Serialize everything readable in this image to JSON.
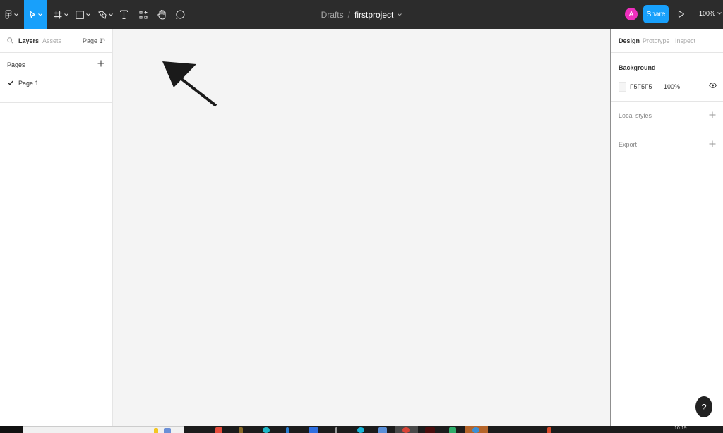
{
  "toolbar": {
    "tools": [
      {
        "name": "main-menu",
        "icon": "figma-logo-icon"
      },
      {
        "name": "move",
        "icon": "move-cursor-icon",
        "active": true
      },
      {
        "name": "frame",
        "icon": "frame-hash-icon"
      },
      {
        "name": "shape",
        "icon": "rectangle-icon"
      },
      {
        "name": "pen",
        "icon": "pen-icon"
      },
      {
        "name": "text",
        "icon": "text-T-icon"
      },
      {
        "name": "resources",
        "icon": "components-icon"
      },
      {
        "name": "hand",
        "icon": "hand-icon"
      },
      {
        "name": "comment",
        "icon": "comment-bubble-icon"
      }
    ],
    "breadcrumb_parent": "Drafts",
    "separator": "/",
    "file_name": "firstproject",
    "avatar_initial": "A",
    "share_label": "Share",
    "zoom_level": "100%",
    "accent_color": "#18a0fb",
    "avatar_color": "#ef2fbd"
  },
  "left_panel": {
    "tabs": {
      "layers": "Layers",
      "assets": "Assets"
    },
    "current_page": "Page 1",
    "pages_heading": "Pages",
    "pages": [
      {
        "label": "Page 1",
        "selected": true
      }
    ]
  },
  "right_panel": {
    "tabs": {
      "design": "Design",
      "prototype": "Prototype",
      "inspect": "Inspect"
    },
    "background": {
      "heading": "Background",
      "hex": "F5F5F5",
      "opacity": "100%"
    },
    "local_styles": "Local styles",
    "export": "Export"
  },
  "help_label": "?",
  "taskbar": {
    "time": "10:19"
  }
}
